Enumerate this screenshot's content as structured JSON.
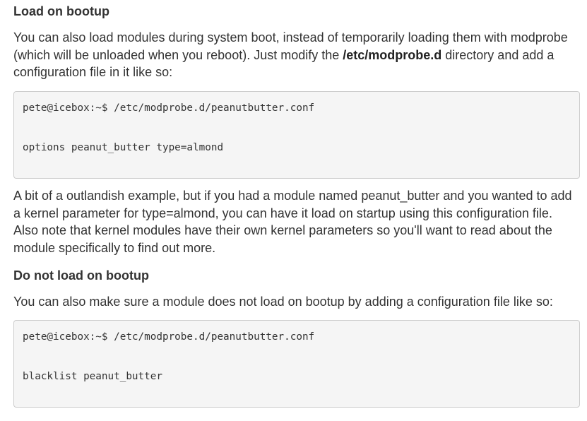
{
  "sections": [
    {
      "heading": "Load on bootup",
      "intro_before": "You can also load modules during system boot, instead of temporarily loading them with modprobe (which will be unloaded when you reboot). Just modify the ",
      "intro_strong": "/etc/modprobe.d",
      "intro_after": " directory and add a configuration file in it like so:",
      "code": {
        "prompt_line": "pete@icebox:~$ /etc/modprobe.d/peanutbutter.conf",
        "blank_line": "",
        "content_line": "options peanut_butter type=almond"
      },
      "followup": "A bit of a outlandish example, but if you had a module named peanut_butter and you wanted to add a kernel parameter for type=almond, you can have it load on startup using this configuration file. Also note that kernel modules have their own kernel parameters so you'll want to read about the module specifically to find out more."
    },
    {
      "heading": "Do not load on bootup",
      "intro": "You can also make sure a module does not load on bootup by adding a configuration file like so:",
      "code": {
        "prompt_line": "pete@icebox:~$ /etc/modprobe.d/peanutbutter.conf",
        "blank_line": "",
        "content_line": "blacklist peanut_butter"
      }
    }
  ]
}
